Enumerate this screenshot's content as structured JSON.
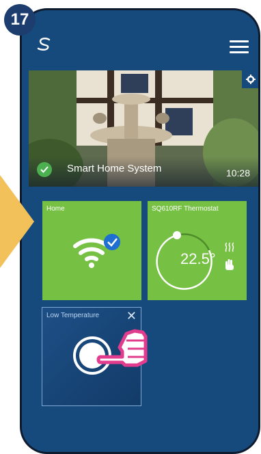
{
  "step_number": "17",
  "header": {
    "logo_icon": "salus-logo-icon",
    "menu_icon": "hamburger-menu-icon"
  },
  "hero": {
    "title": "Smart Home System",
    "time": "10:28",
    "status_icon": "check-circle-icon",
    "settings_icon": "gear-icon"
  },
  "tiles": {
    "home": {
      "label": "Home",
      "icon": "wifi-connected-icon"
    },
    "thermostat": {
      "label": "SQ610RF Thermostat",
      "temperature": "22.5°",
      "heat_icon": "heat-waves-icon",
      "hand_icon": "manual-hand-icon"
    },
    "scene": {
      "label": "Low Temperature",
      "close_icon": "close-icon",
      "button_icon": "scene-button-icon"
    }
  },
  "colors": {
    "background": "#174a7c",
    "tile_green": "#76c043",
    "accent_check": "#4caf50",
    "arrow": "#f2c15a",
    "tap_hand": "#e23c8e"
  }
}
